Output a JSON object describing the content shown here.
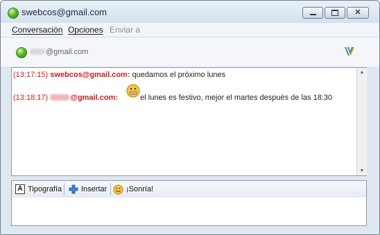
{
  "window": {
    "title": "swebcos@gmail.com",
    "buttons": {
      "minimize": "minimize",
      "maximize": "maximize",
      "close": "✕"
    }
  },
  "menu": {
    "items": [
      {
        "label": "Conversación",
        "enabled": true
      },
      {
        "label": "Opciones",
        "enabled": true
      },
      {
        "label": "Enviar a",
        "enabled": false
      }
    ]
  },
  "contact": {
    "status": "online",
    "email_visible": "@gmail.com",
    "icon": "messenger-v-logo-icon"
  },
  "conversation": {
    "messages": [
      {
        "time": "(13:17:15)",
        "sender": "swebcos@gmail.com:",
        "text": "quedamos el próximo lunes"
      },
      {
        "time": "(13:18:17)",
        "sender": "@gmail.com:",
        "emoticon": "grin-emoticon",
        "text": "el lunes es festivo, mejor el martes después de las 18:30"
      }
    ]
  },
  "toolbar": {
    "font_label": "Tipografía",
    "insert_label": "Insertar",
    "smile_label": "¡Sonría!"
  },
  "colors": {
    "accent_red": "#c81e1e",
    "window_bg": "#dfe8f1",
    "status_green": "#5dbb2c"
  }
}
